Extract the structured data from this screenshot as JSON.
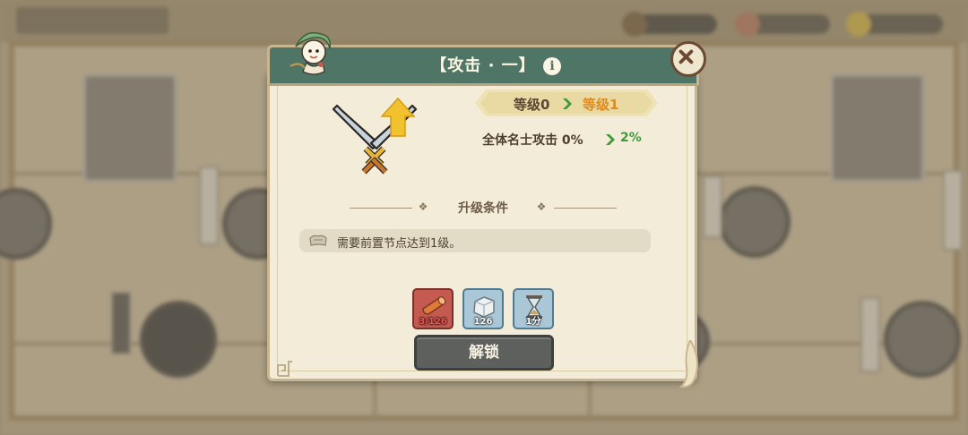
{
  "dialog": {
    "title": "【攻击 · 一】",
    "info_icon_glyph": "i",
    "level_current": "等级0",
    "level_next": "等级1",
    "stat_label": "全体名士攻击 0%",
    "stat_next": "2%",
    "conditions_title": "升级条件",
    "requirement_text": "需要前置节点达到1级。",
    "costs": [
      {
        "icon": "wood-log-icon",
        "value": "3/126",
        "state": "insufficient"
      },
      {
        "icon": "stone-block-icon",
        "value": "126",
        "state": "ok"
      },
      {
        "icon": "hourglass-icon",
        "value": "1分",
        "state": "ok"
      }
    ],
    "unlock_label": "解锁"
  },
  "colors": {
    "title_bar": "#4f7566",
    "panel": "#f3ecd9",
    "level_next": "#e08a1e",
    "stat_up": "#3f9a3c",
    "button": "#5e605d"
  }
}
